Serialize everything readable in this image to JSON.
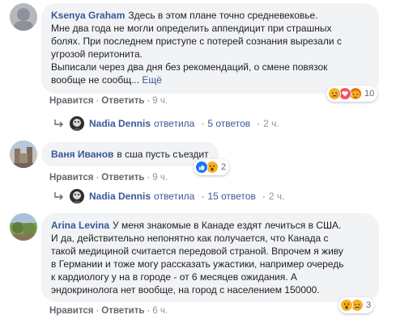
{
  "comments": [
    {
      "author": "Ksenya Graham",
      "lines": [
        "Здесь в этом плане точно средневековье.",
        "Мне два года не могли определить аппендицит при страшных",
        "болях. При последнем приступе с потерей сознания вырезали с",
        "угрозой перитонита.",
        "Выписали через два дня без рекомендаций, о смене повязок",
        "вообще не сообщ... "
      ],
      "more_label": "Ещё",
      "like_label": "Нравится",
      "reply_label": "Ответить",
      "time": "9 ч.",
      "reactions": {
        "icons": [
          "sad",
          "love",
          "angry"
        ],
        "count": "10"
      },
      "replies": {
        "name": "Nadia Dennis",
        "replied": "ответила",
        "count": "5 ответов",
        "time": "2 ч."
      }
    },
    {
      "author": "Ваня Иванов",
      "lines": [
        "в сша пусть съездит"
      ],
      "like_label": "Нравится",
      "reply_label": "Ответить",
      "time": "9 ч.",
      "reactions": {
        "icons": [
          "like",
          "wow"
        ],
        "count": "2"
      },
      "replies": {
        "name": "Nadia Dennis",
        "replied": "ответила",
        "count": "15 ответов",
        "time": "2 ч."
      }
    },
    {
      "author": "Arina Levina",
      "first_line": "У меня знакомые в Канаде ездят лечиться в США.",
      "lines": [
        "И да, действительно непонятно как получается, что Канада с",
        "такой медициной считается передовой страной. Впрочем я живу",
        "в Германии и тоже могу рассказать ужастики, например очередь",
        "к кардиологу у на в городе - от 6 месяцев ожидания. А",
        "эндокринолога нет вообще, на город с населением 150000."
      ],
      "like_label": "Нравится",
      "reply_label": "Ответить",
      "time": "6 ч.",
      "reactions": {
        "icons": [
          "wow",
          "sad"
        ],
        "count": "3"
      }
    }
  ],
  "colors": {
    "link": "#385898",
    "bubble": "#f2f3f5",
    "meta": "#606770",
    "time": "#90949c"
  }
}
